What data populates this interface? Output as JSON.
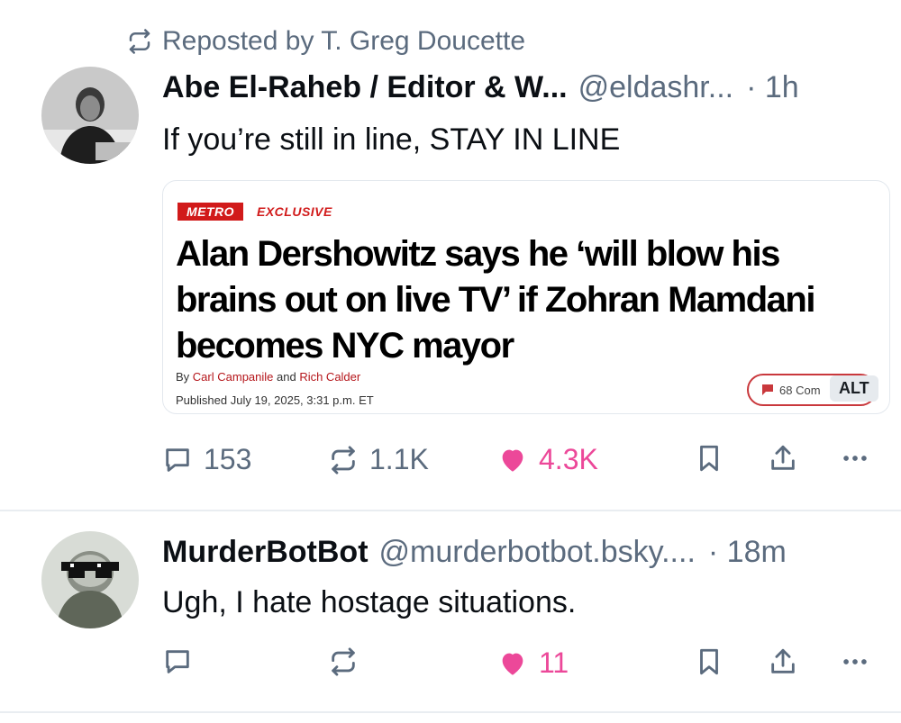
{
  "repost": {
    "label": "Reposted by T. Greg Doucette"
  },
  "post1": {
    "display_name": "Abe El-Raheb / Editor & W...",
    "handle": "@eldashr...",
    "time": "· 1h",
    "text": "If you’re still in line, STAY IN LINE",
    "embed": {
      "tag": "METRO",
      "kicker": "EXCLUSIVE",
      "headline": "Alan Dershowitz says he ‘will blow his brains out on live TV’ if Zohran Mamdani becomes NYC mayor",
      "byline_prefix": "By ",
      "author1": "Carl Campanile",
      "byline_and": " and ",
      "author2": "Rich Calder",
      "published": "Published July 19, 2025, 3:31 p.m. ET",
      "comments": "68 Com",
      "alt": "ALT"
    },
    "actions": {
      "replies": "153",
      "reposts": "1.1K",
      "likes": "4.3K"
    }
  },
  "post2": {
    "display_name": "MurderBotBot",
    "handle": "@murderbotbot.bsky....",
    "time": "· 18m",
    "text": "Ugh, I hate hostage situations.",
    "actions": {
      "replies": "",
      "reposts": "",
      "likes": "11"
    }
  },
  "colors": {
    "like": "#ec4899",
    "muted": "#5b6b7e",
    "metro_red": "#d11a1a"
  },
  "icons": [
    "repost-icon",
    "reply-icon",
    "heart-icon",
    "bookmark-icon",
    "share-icon",
    "more-icon"
  ]
}
